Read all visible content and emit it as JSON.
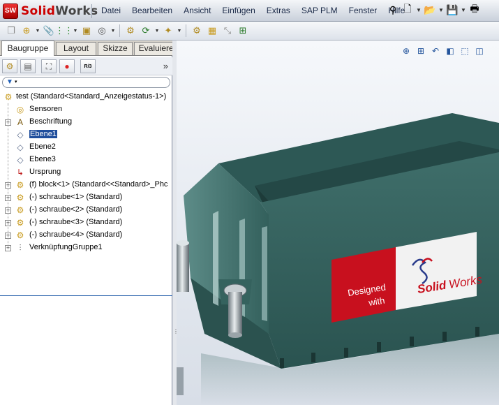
{
  "app": {
    "logo_badge": "SW",
    "brand_solid": "Solid",
    "brand_works": "Works"
  },
  "menu": [
    "Datei",
    "Bearbeiten",
    "Ansicht",
    "Einfügen",
    "Extras",
    "SAP PLM",
    "Fenster",
    "Hilfe"
  ],
  "top_icons": [
    "pin-icon",
    "new-document-icon",
    "open-folder-icon",
    "save-icon",
    "print-icon"
  ],
  "command_icons": [
    "component-icon",
    "insert-component-icon",
    "paperclip-mate-icon",
    "smart-mate-icon",
    "move-component-icon",
    "explode-icon",
    "linear-pattern-icon",
    "rotate-icon",
    "assembly-feature-icon",
    "bill-of-materials-icon",
    "reference-geometry-icon",
    "interference-icon",
    "measure-icon"
  ],
  "tabs": [
    "Baugruppe",
    "Layout",
    "Skizze",
    "Evaluieren"
  ],
  "manager_icons": [
    "featuremanager-icon",
    "propertymanager-icon",
    "configurationmanager-icon",
    "appearance-icon",
    "render-icon"
  ],
  "render_label": "R/3",
  "collapse_glyph": "»",
  "tree": [
    {
      "label": "test  (Standard<Standard_Anzeigestatus-1>)",
      "icon": "assembly-icon",
      "level": 0,
      "expander": false
    },
    {
      "label": "Sensoren",
      "icon": "sensor-icon",
      "level": 1,
      "expander": false
    },
    {
      "label": "Beschriftung",
      "icon": "annotation-icon",
      "level": 1,
      "expander": true
    },
    {
      "label": "Ebene1",
      "icon": "plane-icon",
      "level": 1,
      "expander": false,
      "selected": true
    },
    {
      "label": "Ebene2",
      "icon": "plane-icon",
      "level": 1,
      "expander": false
    },
    {
      "label": "Ebene3",
      "icon": "plane-icon",
      "level": 1,
      "expander": false
    },
    {
      "label": "Ursprung",
      "icon": "origin-icon",
      "level": 1,
      "expander": false
    },
    {
      "label": "(f) block<1> (Standard<<Standard>_Phc",
      "icon": "part-icon",
      "level": 1,
      "expander": true
    },
    {
      "label": "(-) schraube<1> (Standard)",
      "icon": "part-icon",
      "level": 1,
      "expander": true
    },
    {
      "label": "(-) schraube<2> (Standard)",
      "icon": "part-icon",
      "level": 1,
      "expander": true
    },
    {
      "label": "(-) schraube<3> (Standard)",
      "icon": "part-icon",
      "level": 1,
      "expander": true
    },
    {
      "label": "(-) schraube<4> (Standard)",
      "icon": "part-icon",
      "level": 1,
      "expander": true
    },
    {
      "label": "VerknüpfungGruppe1",
      "icon": "mates-icon",
      "level": 1,
      "expander": true
    }
  ],
  "view_icons": [
    "zoom-to-fit-icon",
    "zoom-area-icon",
    "previous-view-icon",
    "section-view-icon",
    "view-orientation-icon",
    "display-style-icon"
  ],
  "model_label": {
    "designed": "Designed",
    "with": "with",
    "solid": "Solid",
    "works": "Works"
  },
  "colors": {
    "model": "#2f5d5a",
    "model_dark": "#1f3f3d",
    "model_light": "#467a76",
    "label_red": "#c8101e",
    "selection": "#1f4e9c"
  }
}
